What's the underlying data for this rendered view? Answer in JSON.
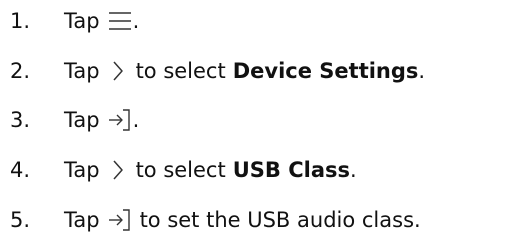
{
  "steps": [
    {
      "number": "1.",
      "tap": "Tap",
      "icon": "menu-icon",
      "end": "."
    },
    {
      "number": "2.",
      "tap": "Tap",
      "icon": "chevron-right-icon",
      "mid": "to select",
      "target": "Device Settings",
      "end": "."
    },
    {
      "number": "3.",
      "tap": "Tap",
      "icon": "enter-icon",
      "end": "."
    },
    {
      "number": "4.",
      "tap": "Tap",
      "icon": "chevron-right-icon",
      "mid": "to select",
      "target": "USB Class",
      "end": "."
    },
    {
      "number": "5.",
      "tap": "Tap",
      "icon": "enter-icon",
      "mid": "to set the USB audio class",
      "end": "."
    }
  ]
}
